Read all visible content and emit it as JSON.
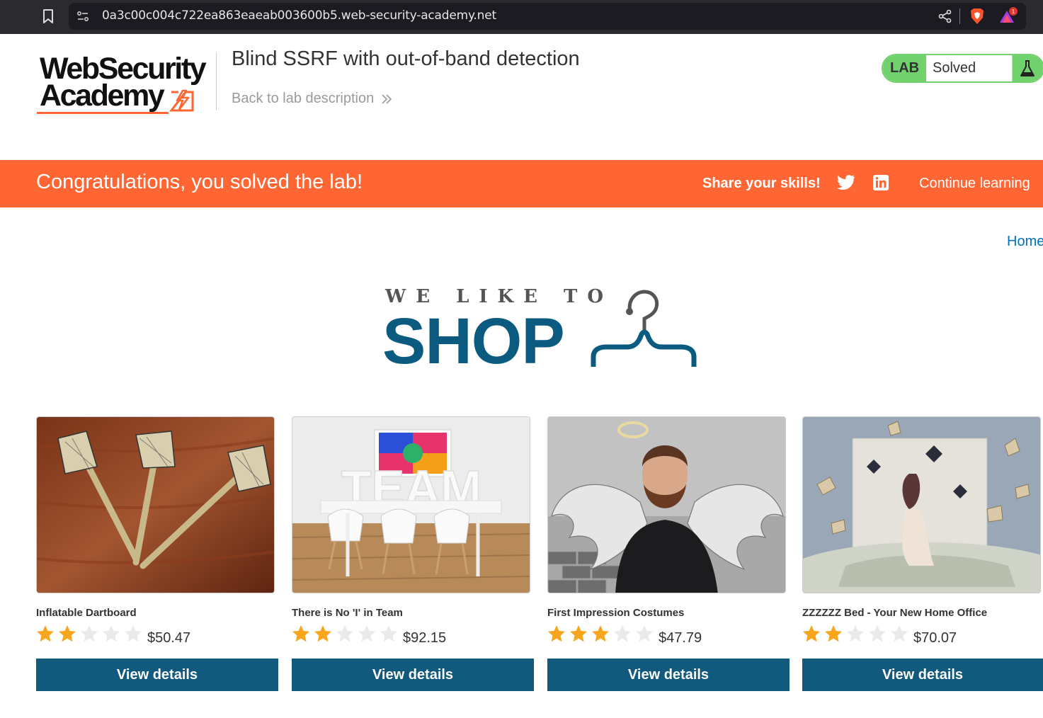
{
  "browser": {
    "url": "0a3c00c004c722ea863eaeab003600b5.web-security-academy.net",
    "icons": [
      "bookmark-icon",
      "site-info-icon",
      "share-icon",
      "brave-shield-icon",
      "brave-rewards-icon"
    ],
    "rewards_badge": "1"
  },
  "header": {
    "logo_line1": "WebSecurity",
    "logo_line2": "Academy",
    "lab_title": "Blind SSRF with out-of-band detection",
    "back_link": "Back to lab description",
    "lab_badge_label": "LAB",
    "lab_status": "Solved",
    "accent_color": "#ff6633",
    "solved_color": "#70d16d"
  },
  "banner": {
    "message": "Congratulations, you solved the lab!",
    "share_label": "Share your skills!",
    "continue_label": "Continue learning"
  },
  "nav": {
    "home": "Home"
  },
  "hero": {
    "top_text": "WE LIKE TO",
    "main_text": "SHOP",
    "brand_color": "#0b5a7f"
  },
  "products": [
    {
      "name": "Inflatable Dartboard",
      "rating": 2,
      "max_rating": 5,
      "price": "$50.47",
      "button": "View details",
      "image": "darts-photo"
    },
    {
      "name": "There is No 'I' in Team",
      "rating": 2,
      "max_rating": 5,
      "price": "$92.15",
      "button": "View details",
      "image": "team-table-photo"
    },
    {
      "name": "First Impression Costumes",
      "rating": 3,
      "max_rating": 5,
      "price": "$47.79",
      "button": "View details",
      "image": "angel-man-photo"
    },
    {
      "name": "ZZZZZZ Bed - Your New Home Office",
      "rating": 2,
      "max_rating": 5,
      "price": "$70.07",
      "button": "View details",
      "image": "bed-books-photo"
    }
  ]
}
